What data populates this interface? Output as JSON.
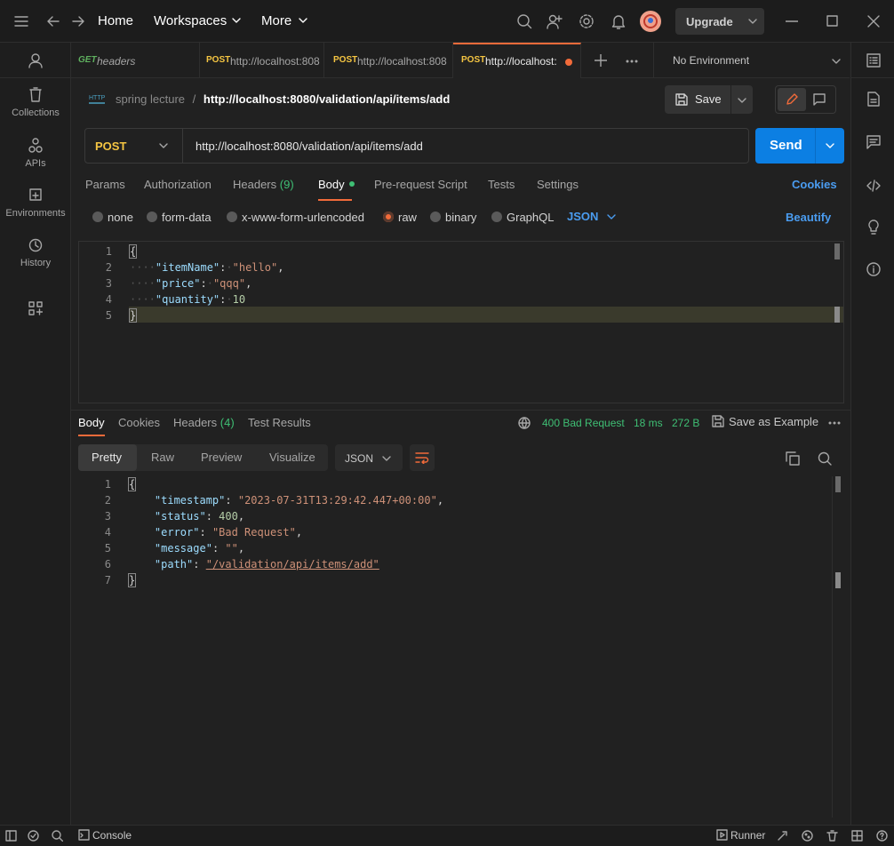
{
  "titlebar": {
    "home": "Home",
    "workspaces": "Workspaces",
    "more": "More",
    "upgrade": "Upgrade"
  },
  "sidebar": {
    "items": [
      {
        "label": "Collections"
      },
      {
        "label": "APIs"
      },
      {
        "label": "Environments"
      },
      {
        "label": "History"
      }
    ]
  },
  "tabs": [
    {
      "method": "GET",
      "label": "headers"
    },
    {
      "method": "POST",
      "label": "http://localhost:808"
    },
    {
      "method": "POST",
      "label": "http://localhost:808"
    },
    {
      "method": "POST",
      "label": "http://localhost:"
    }
  ],
  "environment": "No Environment",
  "breadcrumb": {
    "collection": "spring lecture",
    "separator": "/",
    "request": "http://localhost:8080/validation/api/items/add"
  },
  "save_label": "Save",
  "request": {
    "method": "POST",
    "url": "http://localhost:8080/validation/api/items/add",
    "send": "Send"
  },
  "request_tabs": {
    "params": "Params",
    "authorization": "Authorization",
    "headers": "Headers",
    "headers_count": "(9)",
    "body": "Body",
    "prerequest": "Pre-request Script",
    "tests": "Tests",
    "settings": "Settings",
    "cookies": "Cookies"
  },
  "body_types": {
    "none": "none",
    "formdata": "form-data",
    "urlencoded": "x-www-form-urlencoded",
    "raw": "raw",
    "binary": "binary",
    "graphql": "GraphQL",
    "json": "JSON",
    "beautify": "Beautify"
  },
  "request_body": {
    "line_numbers": [
      "1",
      "2",
      "3",
      "4",
      "5"
    ],
    "open": "{",
    "close": "}",
    "k1": "\"itemName\"",
    "v1": "\"hello\"",
    "k2": "\"price\"",
    "v2": "\"qqq\"",
    "k3": "\"quantity\"",
    "v3": "10"
  },
  "response_tabs": {
    "body": "Body",
    "cookies": "Cookies",
    "headers": "Headers",
    "headers_count": "(4)",
    "tests": "Test Results"
  },
  "response_status": {
    "status": "400 Bad Request",
    "time": "18 ms",
    "size": "272 B",
    "save_example": "Save as Example"
  },
  "view_modes": {
    "pretty": "Pretty",
    "raw": "Raw",
    "preview": "Preview",
    "visualize": "Visualize",
    "format": "JSON"
  },
  "response_body": {
    "line_numbers": [
      "1",
      "2",
      "3",
      "4",
      "5",
      "6",
      "7"
    ],
    "open": "{",
    "close": "}",
    "k1": "\"timestamp\"",
    "v1": "\"2023-07-31T13:29:42.447+00:00\"",
    "k2": "\"status\"",
    "v2": "400",
    "k3": "\"error\"",
    "v3": "\"Bad Request\"",
    "k4": "\"message\"",
    "v4": "\"\"",
    "k5": "\"path\"",
    "v5": "\"/validation/api/items/add\""
  },
  "statusbar": {
    "console": "Console",
    "runner": "Runner"
  },
  "colors": {
    "accent_orange": "#f26b3a",
    "send_blue": "#0c7fe3",
    "status_green": "#3fbf74",
    "post_yellow": "#f5c542",
    "get_green": "#5fb15f"
  }
}
